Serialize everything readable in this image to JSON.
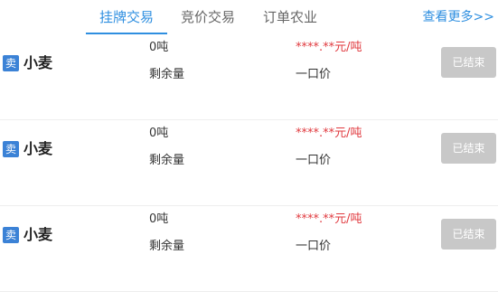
{
  "tabs": [
    {
      "label": "挂牌交易",
      "active": true
    },
    {
      "label": "竞价交易",
      "active": false
    },
    {
      "label": "订单农业",
      "active": false
    }
  ],
  "more_label": "查看更多>>",
  "colors": {
    "accent": "#2f8fe0",
    "price": "#e0393e",
    "badge": "#3b82d6",
    "ended_button": "#c8c8c8"
  },
  "listings": [
    {
      "badge": "卖",
      "product": "小麦",
      "quantity": "0吨",
      "quantity_label": "剩余量",
      "price": "****.**元/吨",
      "price_type": "一口价",
      "status": "已结束"
    },
    {
      "badge": "卖",
      "product": "小麦",
      "quantity": "0吨",
      "quantity_label": "剩余量",
      "price": "****.**元/吨",
      "price_type": "一口价",
      "status": "已结束"
    },
    {
      "badge": "卖",
      "product": "小麦",
      "quantity": "0吨",
      "quantity_label": "剩余量",
      "price": "****.**元/吨",
      "price_type": "一口价",
      "status": "已结束"
    }
  ]
}
